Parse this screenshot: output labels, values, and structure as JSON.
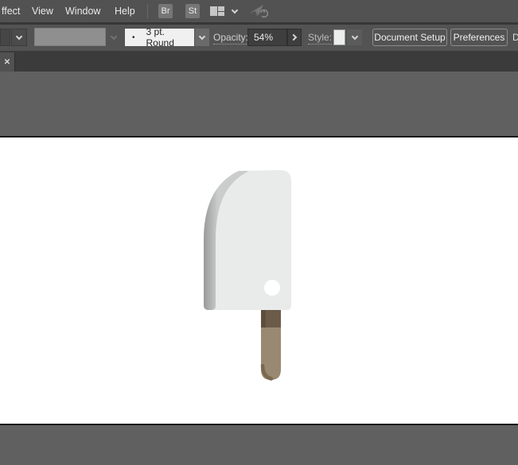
{
  "colors": {
    "bar_background": "#525252",
    "tab_bar_background": "#3B3B3B",
    "pasteboard": "#606060",
    "artboard": "#FFFFFF",
    "blade_body": "#E9EAEA",
    "blade_edge_dark": "#999B9B",
    "blade_edge_light": "#CBCCCC",
    "blade_hole": "#FFFFFF",
    "handle_upper": "#6C5B49",
    "handle_upper_shadow": "#5D4F3F",
    "handle_lower": "#9A8972",
    "handle_tip_shade": "#7A6850"
  },
  "menu_bar": {
    "items": [
      "ffect",
      "View",
      "Window",
      "Help"
    ],
    "bridge_badge": "Br",
    "stock_badge": "St"
  },
  "options_bar": {
    "brush_bullet": "•",
    "brush_value": "3 pt. Round",
    "opacity_label": "Opacity:",
    "opacity_value": "54%",
    "style_label": "Style:",
    "document_setup_button": "Document Setup",
    "preferences_button": "Preferences",
    "clipped_right_text": "D"
  },
  "document_tab": {
    "close_glyph": "✕"
  },
  "canvas": {
    "artwork": "flat meat-cleaver illustration"
  }
}
